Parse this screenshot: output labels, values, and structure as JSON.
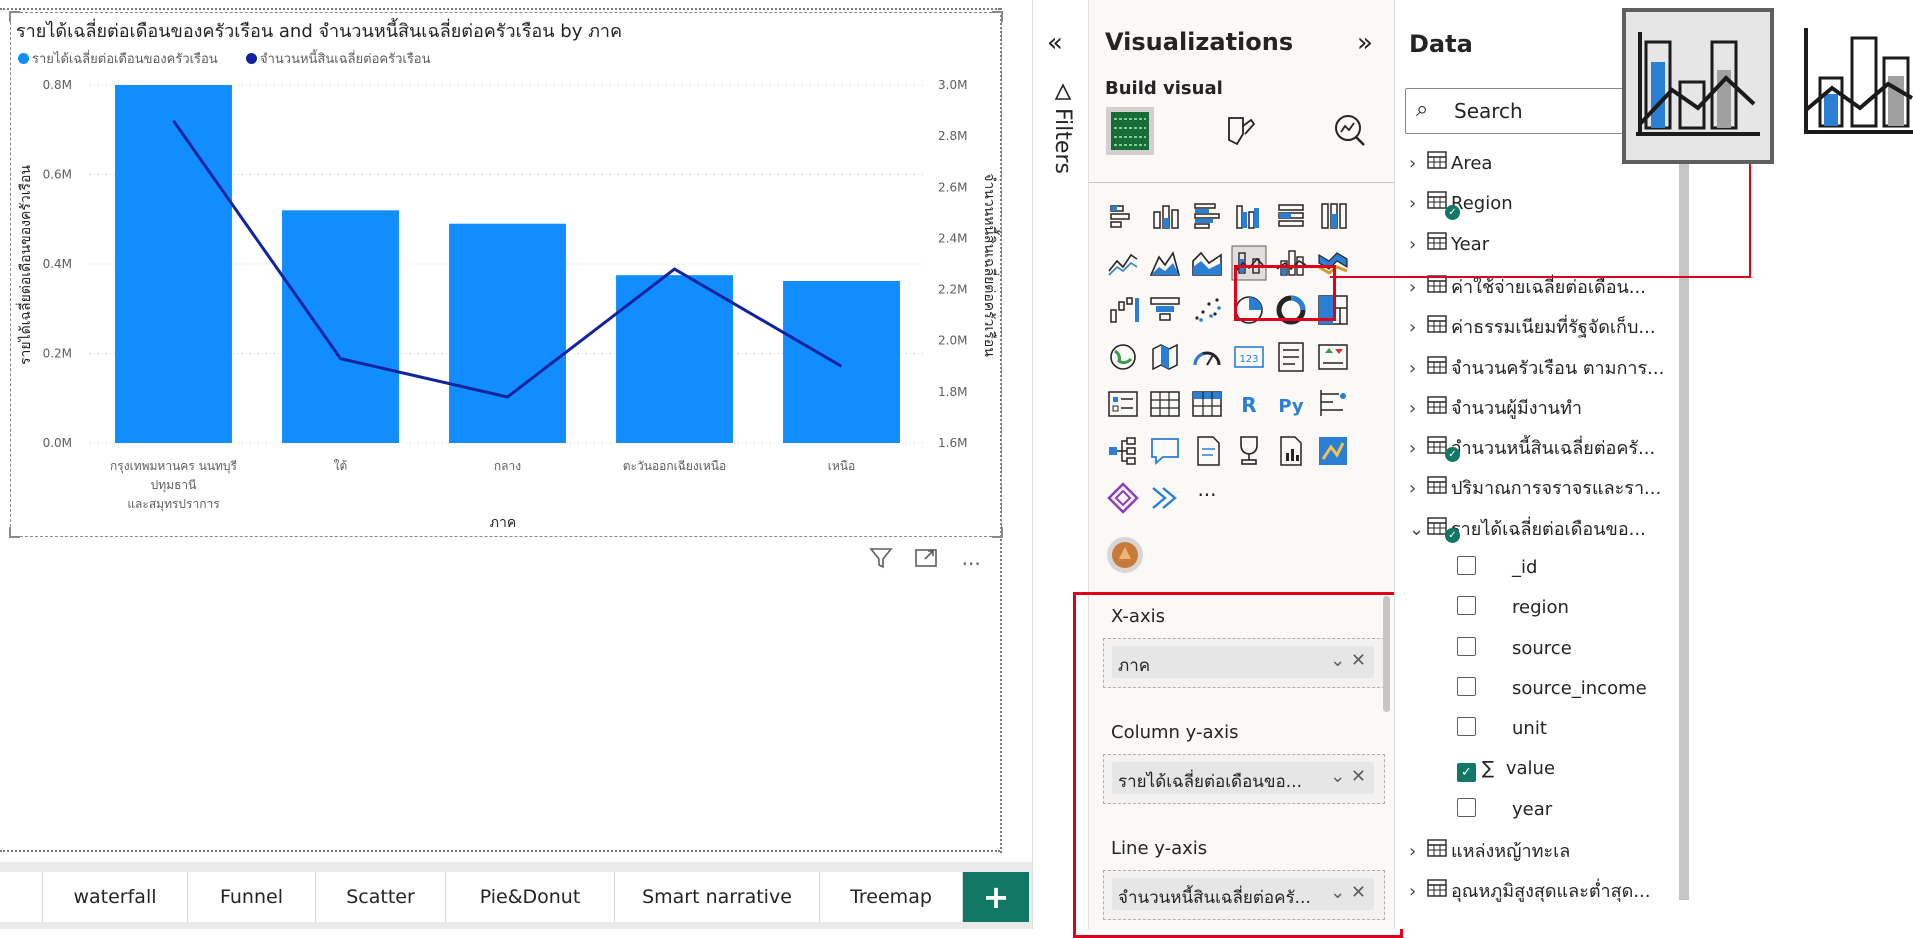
{
  "chart": {
    "title": "รายได้เฉลี่ยต่อเดือนของครัวเรือน and จำนวนหนี้สินเฉลี่ยต่อครัวเรือน by ภาค",
    "legend": [
      {
        "name": "รายได้เฉลี่ยต่อเดือนของครัวเรือน",
        "color": "#118dff"
      },
      {
        "name": "จำนวนหนี้สินเฉลี่ยต่อครัวเรือน",
        "color": "#12239e"
      }
    ]
  },
  "chart_data": {
    "type": "bar",
    "combo": "column-line",
    "title": "รายได้เฉลี่ยต่อเดือนของครัวเรือน and จำนวนหนี้สินเฉลี่ยต่อครัวเรือน by ภาค",
    "xlabel": "ภาค",
    "ylabel": "รายได้เฉลี่ยต่อเดือนของครัวเรือน",
    "y2label": "จำนวนหนี้สินเฉลี่ยต่อครัวเรือน",
    "categories": [
      [
        "กรุงเทพมหานคร นนทบุรี",
        "ปทุมธานี",
        "และสมุทรปราการ"
      ],
      [
        "ใต้"
      ],
      [
        "กลาง"
      ],
      [
        "ตะวันออกเฉียงเหนือ"
      ],
      [
        "เหนือ"
      ]
    ],
    "series": [
      {
        "name": "รายได้เฉลี่ยต่อเดือนของครัวเรือน",
        "axis": "left",
        "kind": "column",
        "color": "#118dff",
        "values": [
          800000,
          520000,
          490000,
          375000,
          362000
        ]
      },
      {
        "name": "จำนวนหนี้สินเฉลี่ยต่อครัวเรือน",
        "axis": "right",
        "kind": "line",
        "color": "#12239e",
        "values": [
          2860000,
          1930000,
          1780000,
          2280000,
          1900000
        ]
      }
    ],
    "ylim": [
      0,
      800000
    ],
    "y2lim": [
      1600000,
      3000000
    ],
    "yticks": [
      "0.0M",
      "0.2M",
      "0.4M",
      "0.6M",
      "0.8M"
    ],
    "y2ticks": [
      "1.6M",
      "1.8M",
      "2.0M",
      "2.2M",
      "2.4M",
      "2.6M",
      "2.8M",
      "3.0M"
    ],
    "grid": true,
    "legend_position": "top-left"
  },
  "tabs": [
    "waterfall",
    "Funnel",
    "Scatter",
    "Pie&Donut",
    "Smart narrative",
    "Treemap"
  ],
  "add_tab": "+",
  "filters": {
    "label": "Filters",
    "collapse_icon": "«"
  },
  "viz": {
    "title": "Visualizations",
    "expand_icon": "»",
    "build_visual": "Build visual",
    "wells": {
      "x_axis_label": "X-axis",
      "x_axis_value": "ภาค",
      "column_y_label": "Column y-axis",
      "column_y_value": "รายได้เฉลี่ยต่อเดือนขอ...",
      "line_y_label": "Line y-axis",
      "line_y_value": "จำนวนหนี้สินเฉลี่ยต่อครั..."
    },
    "more_icon": "···",
    "r_label": "R",
    "py_label": "Py",
    "card_label": "123"
  },
  "data_pane": {
    "title": "Data",
    "search_placeholder": "Search",
    "tables": [
      {
        "name": "Area",
        "expanded": false,
        "checked": false
      },
      {
        "name": "Region",
        "expanded": false,
        "checked": true
      },
      {
        "name": "Year",
        "expanded": false,
        "checked": false
      },
      {
        "name": "ค่าใช้จ่ายเฉลี่ยต่อเดือน...",
        "expanded": false,
        "checked": false
      },
      {
        "name": "ค่าธรรมเนียมที่รัฐจัดเก็บ...",
        "expanded": false,
        "checked": false
      },
      {
        "name": "จำนวนครัวเรือน ตามการ...",
        "expanded": false,
        "checked": false
      },
      {
        "name": "จำนวนผู้มีงานทำ",
        "expanded": false,
        "checked": false
      },
      {
        "name": "จำนวนหนี้สินเฉลี่ยต่อครั...",
        "expanded": false,
        "checked": true
      },
      {
        "name": "ปริมาณการจราจรและรา...",
        "expanded": false,
        "checked": false
      },
      {
        "name": "รายได้เฉลี่ยต่อเดือนขอ...",
        "expanded": true,
        "checked": true
      }
    ],
    "fields": [
      {
        "name": "_id",
        "checked": false
      },
      {
        "name": "region",
        "checked": false
      },
      {
        "name": "source",
        "checked": false
      },
      {
        "name": "source_income",
        "checked": false
      },
      {
        "name": "unit",
        "checked": false
      },
      {
        "name": "value",
        "checked": true,
        "sigma": "∑"
      },
      {
        "name": "year",
        "checked": false
      }
    ],
    "tables_after": [
      {
        "name": "แหล่งหญ้าทะเล"
      },
      {
        "name": "อุณหภูมิสูงสุดและต่ำสุด..."
      }
    ]
  },
  "colors": {
    "column": "#118dff",
    "line": "#12239e",
    "accent": "#117865",
    "highlight": "#e0001a"
  }
}
